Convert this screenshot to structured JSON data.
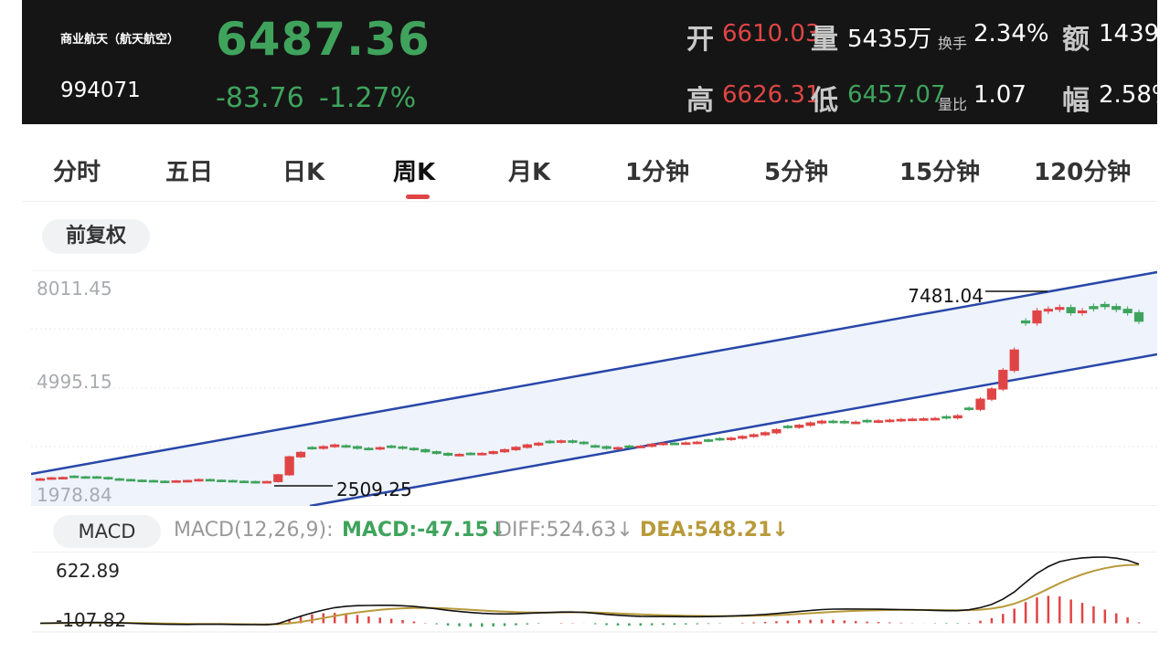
{
  "header": {
    "name": "商业航天（航天航空）",
    "code": "994071",
    "price": "6487.36",
    "change": "-83.76",
    "change_pct": "-1.27%",
    "stats": {
      "open_label": "开",
      "open": "6610.03",
      "volume_label": "量",
      "volume": "5435万",
      "turnover_label": "换手",
      "turnover": "2.34%",
      "amount_label": "额",
      "amount": "1439",
      "high_label": "高",
      "high": "6626.31",
      "low_label": "低",
      "low": "6457.07",
      "vol_ratio_label": "量比",
      "vol_ratio": "1.07",
      "amplitude_label": "幅",
      "amplitude": "2.58%"
    }
  },
  "tabs": [
    "分时",
    "五日",
    "日K",
    "周K",
    "月K",
    "1分钟",
    "5分钟",
    "15分钟",
    "120分钟"
  ],
  "active_tab": "周K",
  "adjust_button": "前复权",
  "kline": {
    "y_labels": [
      "8011.45",
      "4995.15",
      "1978.84"
    ],
    "annot_high": "7481.04",
    "annot_low": "2509.25"
  },
  "macd_panel": {
    "button": "MACD",
    "params": "MACD(12,26,9):",
    "macd": "MACD:-47.15↓",
    "diff": "DIFF:524.63↓",
    "dea": "DEA:548.21↓",
    "y_top": "622.89",
    "y_bottom": "-107.82"
  },
  "colors": {
    "up": "#e04545",
    "down": "#3fa35c",
    "channel_line": "#2847a8",
    "channel_fill": "#eef3fc",
    "dea_line": "#b89a3a",
    "diff_line": "#111111"
  },
  "chart_data": {
    "type": "candlestick",
    "weekly_close": [
      2400,
      2430,
      2440,
      2460,
      2450,
      2440,
      2400,
      2380,
      2360,
      2340,
      2330,
      2320,
      2340,
      2350,
      2380,
      2360,
      2340,
      2330,
      2320,
      2310,
      2320,
      2520,
      3050,
      3180,
      3300,
      3350,
      3400,
      3350,
      3300,
      3280,
      3320,
      3340,
      3300,
      3260,
      3200,
      3150,
      3100,
      3120,
      3130,
      3150,
      3200,
      3260,
      3330,
      3400,
      3450,
      3480,
      3520,
      3480,
      3440,
      3350,
      3300,
      3320,
      3340,
      3360,
      3420,
      3450,
      3440,
      3460,
      3480,
      3520,
      3560,
      3600,
      3650,
      3700,
      3760,
      3850,
      3920,
      3980,
      4050,
      4100,
      4080,
      4060,
      4070,
      4090,
      4110,
      4130,
      4150,
      4160,
      4170,
      4180,
      4200,
      4260,
      4450,
      4750,
      5050,
      5600,
      6200,
      7000,
      7350,
      7400,
      7450,
      7300,
      7350,
      7420,
      7481.04,
      7400,
      7300,
      7050
    ],
    "y_range": [
      1978.84,
      8011.45
    ],
    "macd_range": [
      -107.82,
      622.89
    ]
  }
}
